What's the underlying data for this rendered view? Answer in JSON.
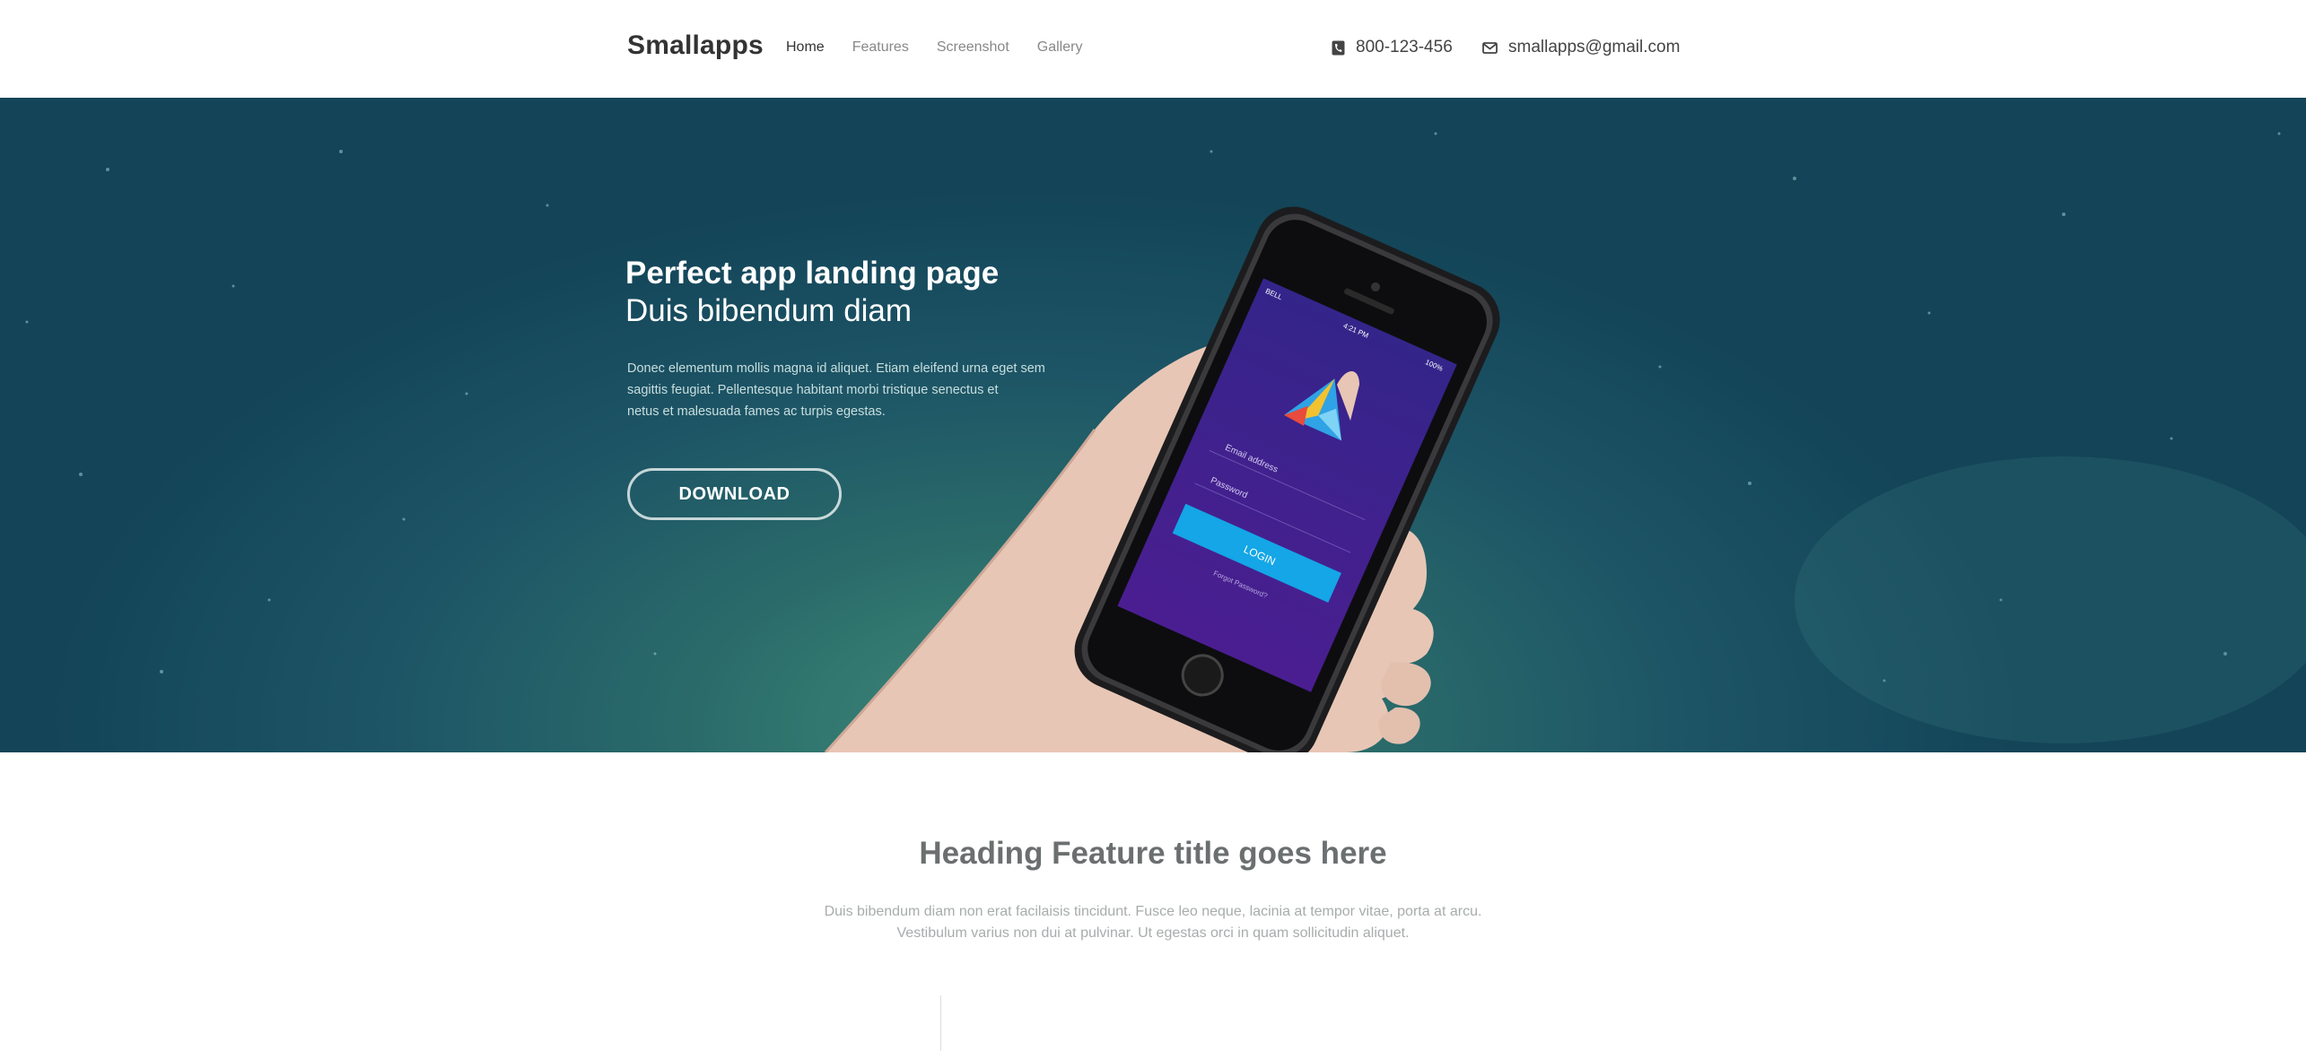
{
  "header": {
    "logo": "Smallapps",
    "nav": [
      {
        "label": "Home",
        "active": true
      },
      {
        "label": "Features",
        "active": false
      },
      {
        "label": "Screenshot",
        "active": false
      },
      {
        "label": "Gallery",
        "active": false
      }
    ],
    "phone": "800-123-456",
    "email": "smallapps@gmail.com",
    "icons": {
      "phone": "phone-icon",
      "email": "envelope-icon"
    }
  },
  "hero": {
    "title": "Perfect app landing page",
    "subtitle": "Duis bibendum diam",
    "text_lines": [
      "Donec elementum mollis magna id aliquet. Etiam eleifend urna eget sem",
      "sagittis feugiat. Pellentesque habitant morbi tristique senectus et",
      "netus et malesuada fames ac turpis egestas."
    ],
    "download_label": "DOWNLOAD",
    "phone_screen": {
      "carrier": "BELL",
      "time": "4:21 PM",
      "battery": "100%",
      "email_placeholder": "Email address",
      "password_placeholder": "Password",
      "login_label": "LOGIN",
      "forgot_label": "Forgot Password?"
    },
    "colors": {
      "background": "#1d5566",
      "accent_button": "#14a6e6",
      "screen": "#3b1d86"
    }
  },
  "features": {
    "title": "Heading Feature title goes here",
    "text_lines": [
      "Duis bibendum diam non erat facilaisis tincidunt. Fusce leo neque, lacinia at tempor vitae, porta at arcu.",
      "Vestibulum varius non dui at pulvinar. Ut egestas orci in quam sollicitudin aliquet."
    ]
  }
}
